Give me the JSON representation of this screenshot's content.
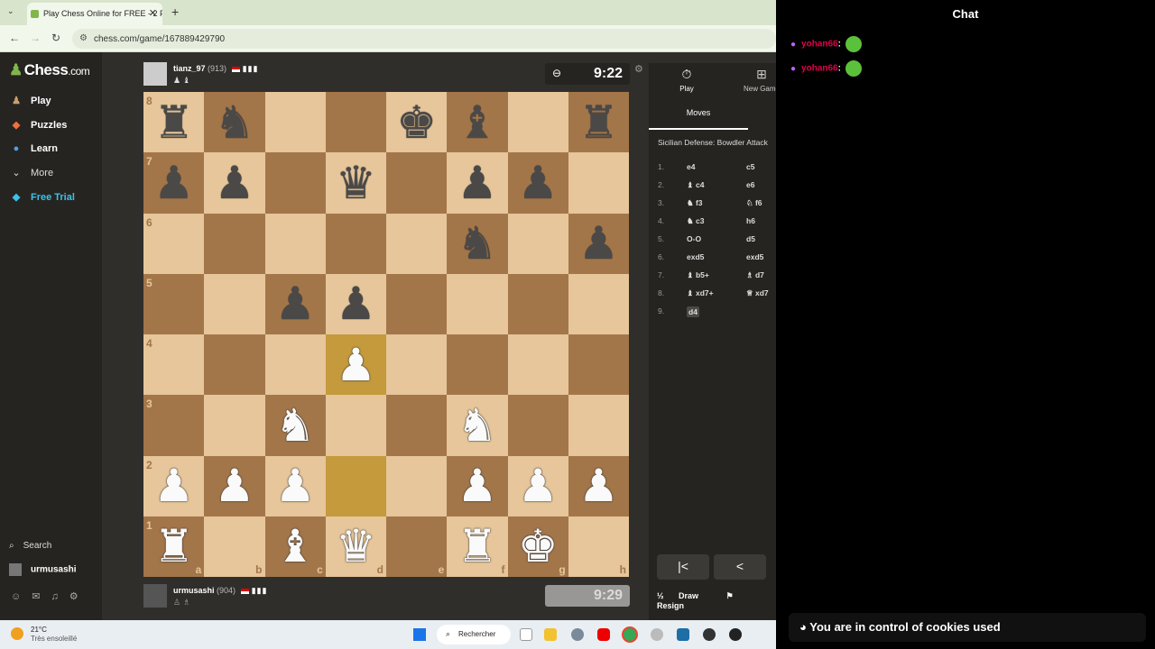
{
  "browser": {
    "tab_title": "Play Chess Online for FREE - 2 P",
    "url": "chess.com/game/167889429790",
    "menu_icon": "chevron-down-icon",
    "new_tab": "+",
    "close": "✕"
  },
  "sidebar": {
    "logo": "Chess",
    "logo_suffix": ".com",
    "items": [
      {
        "label": "Play",
        "icon": "♟",
        "color": "#c9a06a"
      },
      {
        "label": "Puzzles",
        "icon": "◆",
        "color": "#f07040"
      },
      {
        "label": "Learn",
        "icon": "●",
        "color": "#4fa0e0"
      },
      {
        "label": "More",
        "icon": "⌄",
        "color": "#ffffff"
      },
      {
        "label": "Free Trial",
        "icon": "◆",
        "color": "#3ec1e8"
      }
    ],
    "search": "Search",
    "username": "urmusashi"
  },
  "game": {
    "top_player": {
      "name": "tianz_97",
      "rating": "(913)",
      "clock": "9:22"
    },
    "bottom_player": {
      "name": "urmusashi",
      "rating": "(904)",
      "clock": "9:29"
    },
    "board": [
      [
        "r",
        "n",
        "",
        "",
        "k",
        "b",
        "",
        "r"
      ],
      [
        "p",
        "p",
        "",
        "q",
        "",
        "p",
        "p",
        ""
      ],
      [
        "",
        "",
        "",
        "",
        "",
        "n",
        "",
        "p"
      ],
      [
        "",
        "",
        "p",
        "p",
        "",
        "",
        "",
        ""
      ],
      [
        "",
        "",
        "",
        "P",
        "",
        "",
        "",
        ""
      ],
      [
        "",
        "",
        "N",
        "",
        "",
        "N",
        "",
        ""
      ],
      [
        "P",
        "P",
        "P",
        "",
        "",
        "P",
        "P",
        "P"
      ],
      [
        "R",
        "",
        "B",
        "Q",
        "",
        "R",
        "K",
        ""
      ]
    ],
    "highlight_squares": [
      "d4",
      "d2"
    ],
    "files": [
      "a",
      "b",
      "c",
      "d",
      "e",
      "f",
      "g",
      "h"
    ],
    "ranks": [
      "8",
      "7",
      "6",
      "5",
      "4",
      "3",
      "2",
      "1"
    ]
  },
  "panel": {
    "play_tab": "Play",
    "new_game_tab": "New Game",
    "moves_tab": "Moves",
    "opening": "Sicilian Defense: Bowdler Attack",
    "moves": [
      {
        "n": "1.",
        "w": "e4",
        "b": "c5"
      },
      {
        "n": "2.",
        "w": "♝ c4",
        "b": "e6"
      },
      {
        "n": "3.",
        "w": "♞ f3",
        "b": "♘ f6"
      },
      {
        "n": "4.",
        "w": "♞ c3",
        "b": "h6"
      },
      {
        "n": "5.",
        "w": "O-O",
        "b": "d5"
      },
      {
        "n": "6.",
        "w": "exd5",
        "b": "exd5"
      },
      {
        "n": "7.",
        "w": "♝ b5+",
        "b": "♗ d7"
      },
      {
        "n": "8.",
        "w": "♝ xd7+",
        "b": "♕ xd7"
      },
      {
        "n": "9.",
        "w": "d4",
        "b": ""
      }
    ],
    "first_button": "|<",
    "prev_button": "<",
    "draw_label": "Draw",
    "resign_label": "Resign",
    "draw_icon": "½",
    "resign_icon": "⚑"
  },
  "taskbar": {
    "temp": "21°C",
    "weather": "Très ensoleillé",
    "search": "Rechercher"
  },
  "chat": {
    "title": "Chat",
    "messages": [
      {
        "user": "yohan66"
      },
      {
        "user": "yohan66"
      }
    ],
    "cookie_banner": "You are in control of cookies used"
  }
}
